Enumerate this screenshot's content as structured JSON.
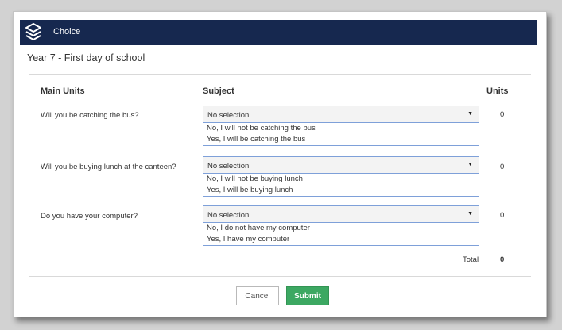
{
  "window": {
    "title": "Choice"
  },
  "page": {
    "title": "Year 7 - First day of school"
  },
  "columns": {
    "main_units": "Main Units",
    "subject": "Subject",
    "units": "Units"
  },
  "rows": [
    {
      "question": "Will you be catching the bus?",
      "selected": "No selection",
      "options": [
        "No, I will not be catching the bus",
        "Yes, I will be catching the bus"
      ],
      "units": "0"
    },
    {
      "question": "Will you be buying lunch at the canteen?",
      "selected": "No selection",
      "options": [
        "No, I will not be buying lunch",
        "Yes, I will be buying lunch"
      ],
      "units": "0"
    },
    {
      "question": "Do you have your computer?",
      "selected": "No selection",
      "options": [
        "No, I do not have my computer",
        "Yes, I have my computer"
      ],
      "units": "0"
    }
  ],
  "total": {
    "label": "Total",
    "value": "0"
  },
  "buttons": {
    "cancel": "Cancel",
    "submit": "Submit"
  },
  "colors": {
    "header": "#16284f",
    "submit": "#3ca862",
    "select_border": "#7ea0d9"
  },
  "icons": {
    "logo": "stacked-layers-icon",
    "caret": "caret-down-icon"
  }
}
